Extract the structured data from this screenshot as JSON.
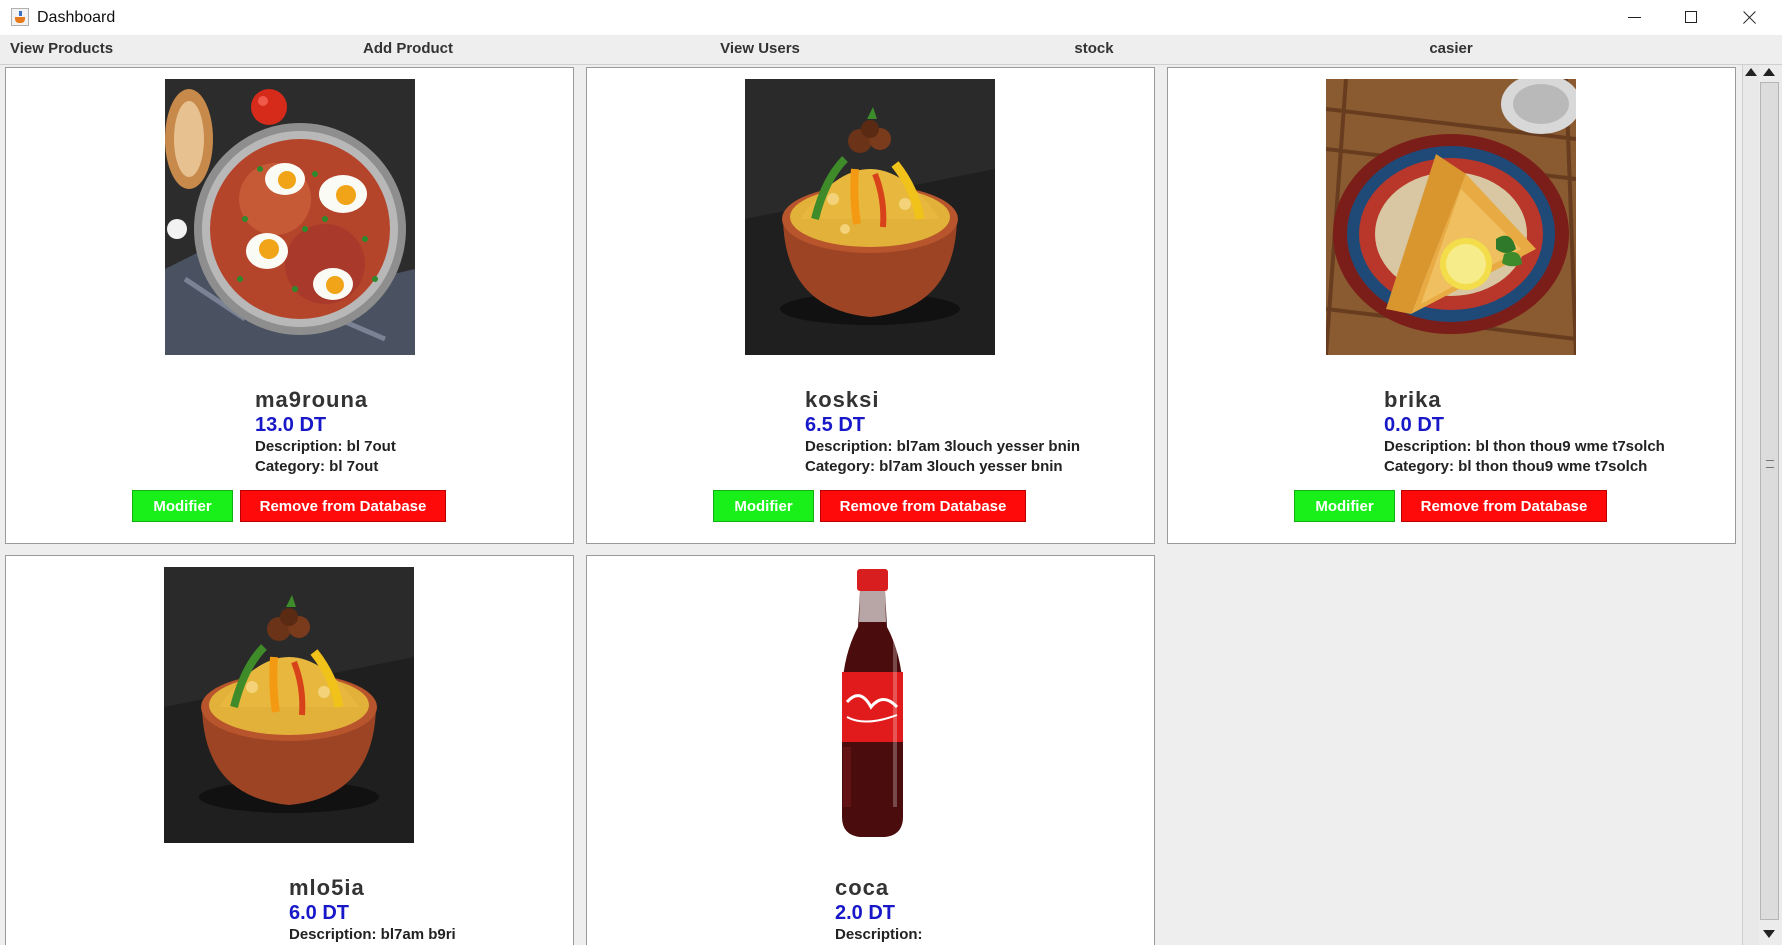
{
  "window": {
    "title": "Dashboard"
  },
  "menu": [
    "View Products",
    "Add Product",
    "View Users",
    "stock",
    "casier"
  ],
  "buttons": {
    "modify": "Modifier",
    "remove": "Remove from Database"
  },
  "products": [
    {
      "name": "ma9rouna",
      "price": "13.0 DT",
      "description": "Description: bl 7out",
      "category": "Category: bl 7out"
    },
    {
      "name": "kosksi",
      "price": "6.5 DT",
      "description": "Description: bl7am 3louch yesser bnin",
      "category": "Category: bl7am 3louch yesser bnin"
    },
    {
      "name": "brika",
      "price": "0.0 DT",
      "description": "Description: bl thon thou9 wme t7solch",
      "category": "Category: bl thon thou9 wme t7solch"
    },
    {
      "name": "mlo5ia",
      "price": "6.0 DT",
      "description": "Description: bl7am b9ri"
    },
    {
      "name": "coca",
      "price": "2.0 DT",
      "description": "Description:"
    }
  ]
}
